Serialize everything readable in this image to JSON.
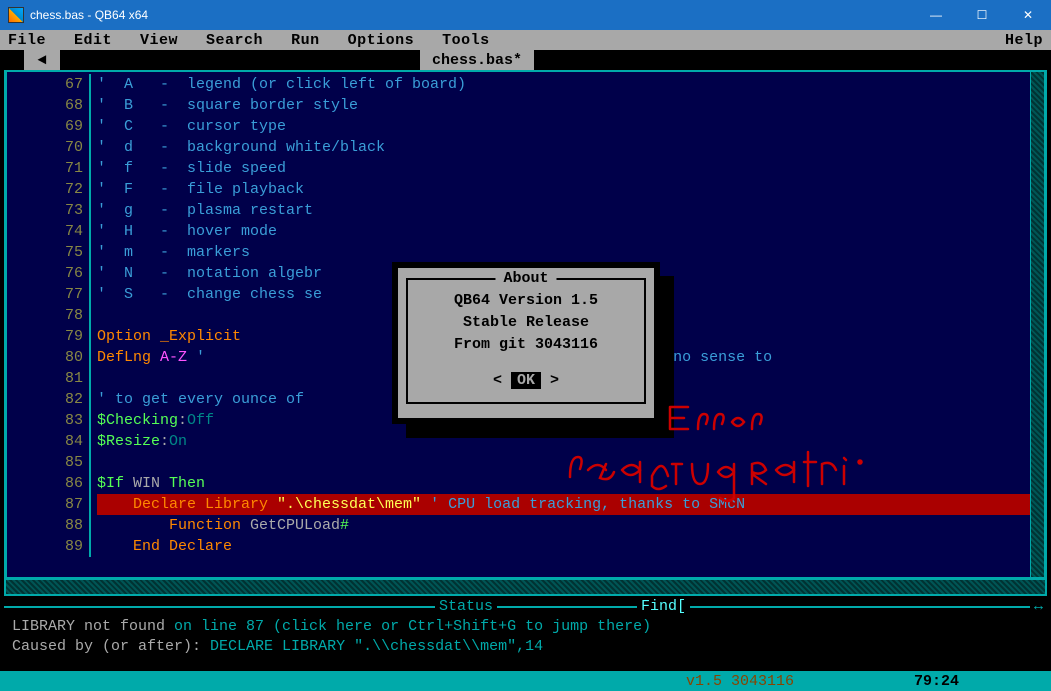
{
  "window": {
    "title": "chess.bas - QB64 x64",
    "minimize": "—",
    "maximize": "☐",
    "close": "✕"
  },
  "menu": {
    "items": [
      "File",
      "Edit",
      "View",
      "Search",
      "Run",
      "Options",
      "Tools"
    ],
    "help": "Help"
  },
  "tabs": {
    "arrow": "◄",
    "active": "chess.bas*"
  },
  "code": {
    "lines": [
      {
        "n": 67,
        "segs": [
          [
            "c-comment",
            "'  A   -  legend (or click left of board)"
          ]
        ]
      },
      {
        "n": 68,
        "segs": [
          [
            "c-comment",
            "'  B   -  square border style"
          ]
        ]
      },
      {
        "n": 69,
        "segs": [
          [
            "c-comment",
            "'  C   -  cursor type"
          ]
        ]
      },
      {
        "n": 70,
        "segs": [
          [
            "c-comment",
            "'  d   -  background white/black"
          ]
        ]
      },
      {
        "n": 71,
        "segs": [
          [
            "c-comment",
            "'  f   -  slide speed"
          ]
        ]
      },
      {
        "n": 72,
        "segs": [
          [
            "c-comment",
            "'  F   -  file playback"
          ]
        ]
      },
      {
        "n": 73,
        "segs": [
          [
            "c-comment",
            "'  g   -  plasma restart"
          ]
        ]
      },
      {
        "n": 74,
        "segs": [
          [
            "c-comment",
            "'  H   -  hover mode"
          ]
        ]
      },
      {
        "n": 75,
        "segs": [
          [
            "c-comment",
            "'  m   -  markers"
          ]
        ]
      },
      {
        "n": 76,
        "segs": [
          [
            "c-comment",
            "'  N   -  notation algebr"
          ]
        ]
      },
      {
        "n": 77,
        "segs": [
          [
            "c-comment",
            "'  S   -  change chess se"
          ]
        ]
      },
      {
        "n": 78,
        "segs": []
      },
      {
        "n": 79,
        "segs": [
          [
            "c-orange",
            "Option _Explicit"
          ]
        ]
      },
      {
        "n": 80,
        "segs": [
          [
            "c-orange",
            "DefLng "
          ],
          [
            "c-magenta",
            "A-Z "
          ],
          [
            "c-comment",
            "'                                   n integer, makes no sense to"
          ]
        ]
      },
      {
        "n": 81,
        "segs": []
      },
      {
        "n": 82,
        "segs": [
          [
            "c-comment",
            "' to get every ounce of"
          ]
        ]
      },
      {
        "n": 83,
        "segs": [
          [
            "c-green",
            "$Checking"
          ],
          [
            "c-gray",
            ":"
          ],
          [
            "c-darkcyan",
            "Off"
          ]
        ]
      },
      {
        "n": 84,
        "segs": [
          [
            "c-green",
            "$Resize"
          ],
          [
            "c-gray",
            ":"
          ],
          [
            "c-darkcyan",
            "On"
          ]
        ]
      },
      {
        "n": 85,
        "segs": []
      },
      {
        "n": 86,
        "segs": [
          [
            "c-green",
            "$If "
          ],
          [
            "c-gray",
            "WIN "
          ],
          [
            "c-green",
            "Then"
          ]
        ]
      },
      {
        "n": 87,
        "red": true,
        "segs": [
          [
            "c-orange",
            "    Declare Library "
          ],
          [
            "c-yellow",
            "\".\\chessdat\\mem\" "
          ],
          [
            "c-comment",
            "' CPU load tracking, thanks to SMcN"
          ]
        ]
      },
      {
        "n": 88,
        "segs": [
          [
            "c-orange",
            "        Function "
          ],
          [
            "c-gray",
            "GetCPULoad"
          ],
          [
            "c-green",
            "#"
          ]
        ]
      },
      {
        "n": 89,
        "segs": [
          [
            "c-orange",
            "    End Declare"
          ]
        ]
      }
    ]
  },
  "dialog": {
    "title": "About",
    "line1": "QB64 Version 1.5",
    "line2": "Stable Release",
    "line3": "From git 3043116",
    "ok": "OK"
  },
  "status": {
    "header_status": "Status",
    "header_find": "Find[",
    "l1a": "LIBRARY not found ",
    "l1b": "on line 87 (click here or Ctrl+Shift+G to jump there)",
    "l2a": "Caused by (or after): ",
    "l2b": "DECLARE LIBRARY \".\\\\chessdat\\\\mem\",14"
  },
  "bottom": {
    "version": "v1.5 3043116",
    "cursor": "79:24"
  },
  "handwriting_label": "Error reading path"
}
